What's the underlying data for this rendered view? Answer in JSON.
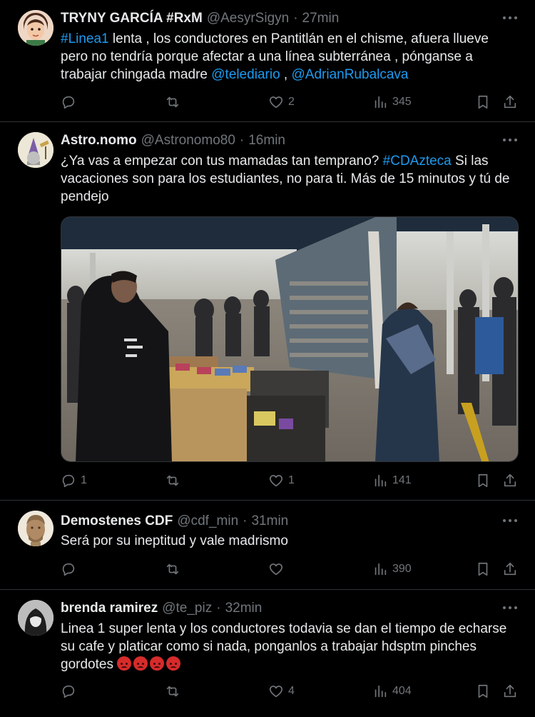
{
  "tweets": [
    {
      "name": "TRYNY GARCÍA #RxM",
      "handle": "@AesyrSigyn",
      "time": "27min",
      "text_parts": [
        "#Linea1",
        " lenta , los conductores en Pantitlán en el chisme, afuera llueve pero no tendría porque afectar a una línea subterránea , pónganse a trabajar chingada madre ",
        "@telediario",
        " , ",
        "@AdrianRubalcava"
      ],
      "replies": "",
      "retweets": "",
      "likes": "2",
      "views": "345"
    },
    {
      "name": "Astro.nomo",
      "handle": "@Astronomo80",
      "time": "16min",
      "text_parts": [
        "¿Ya vas a empezar con tus mamadas tan temprano? ",
        "#CDAzteca",
        " Si las vacaciones son para los estudiantes, no para ti. Más de 15 minutos y tú de pendejo"
      ],
      "replies": "1",
      "retweets": "",
      "likes": "1",
      "views": "141"
    },
    {
      "name": "Demostenes CDF",
      "handle": "@cdf_min",
      "time": "31min",
      "text": "Será por su ineptitud y vale madrismo",
      "replies": "",
      "retweets": "",
      "likes": "",
      "views": "390"
    },
    {
      "name": "brenda ramirez",
      "handle": "@te_piz",
      "time": "32min",
      "text": "Linea 1 super lenta y los conductores todavia se dan el tiempo de echarse su cafe y platicar como si nada, ponganlos a trabajar hdsptm pinches gordotes",
      "emoji_count": 4,
      "replies": "",
      "retweets": "",
      "likes": "4",
      "views": "404"
    }
  ],
  "colors": {
    "background": "#000000",
    "text": "#e7e9ea",
    "muted": "#71767b",
    "link": "#1d9bf0",
    "border": "#2f3336"
  },
  "icons": [
    "more-icon",
    "reply-icon",
    "retweet-icon",
    "like-icon",
    "views-icon",
    "bookmark-icon",
    "share-icon"
  ]
}
